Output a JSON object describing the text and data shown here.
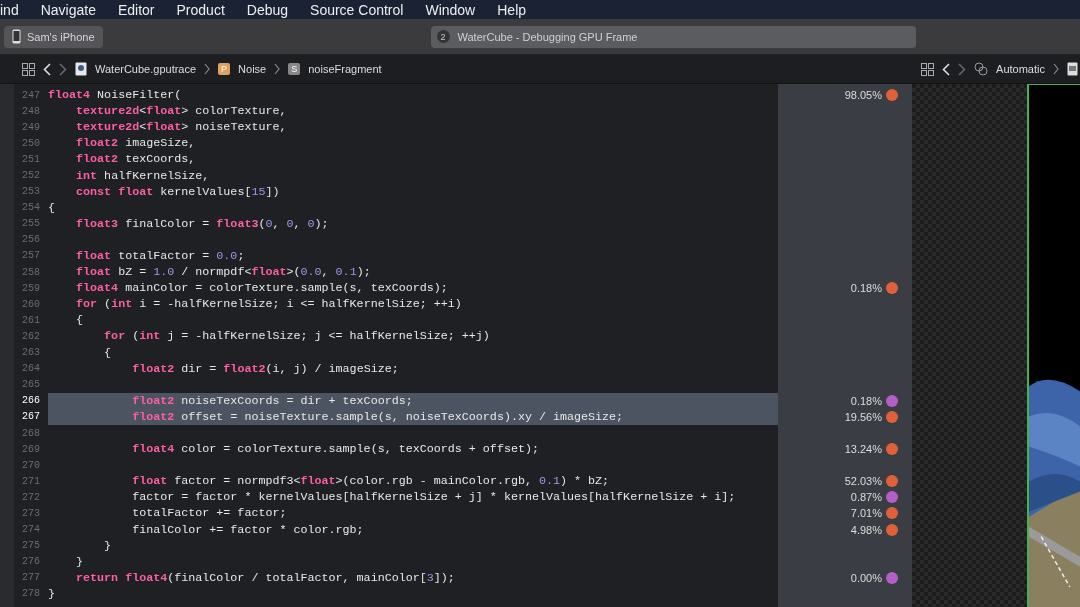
{
  "menu_bar": [
    "ind",
    "Navigate",
    "Editor",
    "Product",
    "Debug",
    "Source Control",
    "Window",
    "Help"
  ],
  "toolbar": {
    "scheme": "Sam's iPhone",
    "activity": {
      "badge": "2",
      "title": "WaterCube - Debugging GPU Frame"
    }
  },
  "jump_bar": {
    "path": [
      {
        "label": "WaterCube.gputrace"
      },
      {
        "label": "Noise",
        "badge": "P"
      },
      {
        "label": "noiseFragment",
        "badge": "S"
      }
    ],
    "assistant": "Automatic"
  },
  "lines": [
    {
      "n": "247",
      "selected": false,
      "code": [
        {
          "kind": "keyword",
          "text": "float4"
        },
        {
          "kind": "plain",
          "text": " NoiseFilter("
        }
      ],
      "cost": "98.05%",
      "color": "#e0603a"
    },
    {
      "n": "248",
      "selected": false,
      "code": [
        {
          "kind": "keyword",
          "text": "    texture2d"
        },
        {
          "kind": "plain",
          "text": "<"
        },
        {
          "kind": "keyword",
          "text": "float"
        },
        {
          "kind": "plain",
          "text": "> colorTexture,"
        }
      ]
    },
    {
      "n": "249",
      "selected": false,
      "code": [
        {
          "kind": "keyword",
          "text": "    texture2d"
        },
        {
          "kind": "plain",
          "text": "<"
        },
        {
          "kind": "keyword",
          "text": "float"
        },
        {
          "kind": "plain",
          "text": "> noiseTexture,"
        }
      ]
    },
    {
      "n": "250",
      "selected": false,
      "code": [
        {
          "kind": "keyword",
          "text": "    float2"
        },
        {
          "kind": "plain",
          "text": " imageSize,"
        }
      ]
    },
    {
      "n": "251",
      "selected": false,
      "code": [
        {
          "kind": "keyword",
          "text": "    float2"
        },
        {
          "kind": "plain",
          "text": " texCoords,"
        }
      ]
    },
    {
      "n": "252",
      "selected": false,
      "code": [
        {
          "kind": "keyword",
          "text": "    int"
        },
        {
          "kind": "plain",
          "text": " halfKernelSize,"
        }
      ]
    },
    {
      "n": "253",
      "selected": false,
      "code": [
        {
          "kind": "keyword",
          "text": "    const float"
        },
        {
          "kind": "plain",
          "text": " kernelValues["
        },
        {
          "kind": "number",
          "text": "15"
        },
        {
          "kind": "plain",
          "text": "])"
        }
      ]
    },
    {
      "n": "254",
      "selected": false,
      "code": [
        {
          "kind": "plain",
          "text": "{"
        }
      ]
    },
    {
      "n": "255",
      "selected": false,
      "code": [
        {
          "kind": "keyword",
          "text": "    float3"
        },
        {
          "kind": "plain",
          "text": " finalColor = "
        },
        {
          "kind": "keyword",
          "text": "float3"
        },
        {
          "kind": "plain",
          "text": "("
        },
        {
          "kind": "number",
          "text": "0"
        },
        {
          "kind": "plain",
          "text": ", "
        },
        {
          "kind": "number",
          "text": "0"
        },
        {
          "kind": "plain",
          "text": ", "
        },
        {
          "kind": "number",
          "text": "0"
        },
        {
          "kind": "plain",
          "text": ");"
        }
      ]
    },
    {
      "n": "256",
      "selected": false
    },
    {
      "n": "257",
      "selected": false,
      "code": [
        {
          "kind": "keyword",
          "text": "    float"
        },
        {
          "kind": "plain",
          "text": " totalFactor = "
        },
        {
          "kind": "number",
          "text": "0.0"
        },
        {
          "kind": "plain",
          "text": ";"
        }
      ]
    },
    {
      "n": "258",
      "selected": false,
      "code": [
        {
          "kind": "keyword",
          "text": "    float"
        },
        {
          "kind": "plain",
          "text": " bZ = "
        },
        {
          "kind": "number",
          "text": "1.0"
        },
        {
          "kind": "plain",
          "text": " / normpdf<"
        },
        {
          "kind": "keyword",
          "text": "float"
        },
        {
          "kind": "plain",
          "text": ">("
        },
        {
          "kind": "number",
          "text": "0.0"
        },
        {
          "kind": "plain",
          "text": ", "
        },
        {
          "kind": "number",
          "text": "0.1"
        },
        {
          "kind": "plain",
          "text": ");"
        }
      ]
    },
    {
      "n": "259",
      "selected": false,
      "code": [
        {
          "kind": "keyword",
          "text": "    float4"
        },
        {
          "kind": "plain",
          "text": " mainColor = colorTexture.sample(s, texCoords);"
        }
      ],
      "cost": "0.18%",
      "color": "#e0603a"
    },
    {
      "n": "260",
      "selected": false,
      "code": [
        {
          "kind": "keyword",
          "text": "    for"
        },
        {
          "kind": "plain",
          "text": " ("
        },
        {
          "kind": "keyword",
          "text": "int"
        },
        {
          "kind": "plain",
          "text": " i = -halfKernelSize; i <= halfKernelSize; ++i)"
        }
      ]
    },
    {
      "n": "261",
      "selected": false,
      "code": [
        {
          "kind": "plain",
          "text": "    {"
        }
      ]
    },
    {
      "n": "262",
      "selected": false,
      "code": [
        {
          "kind": "keyword",
          "text": "        for"
        },
        {
          "kind": "plain",
          "text": " ("
        },
        {
          "kind": "keyword",
          "text": "int"
        },
        {
          "kind": "plain",
          "text": " j = -halfKernelSize; j <= halfKernelSize; ++j)"
        }
      ]
    },
    {
      "n": "263",
      "selected": false,
      "code": [
        {
          "kind": "plain",
          "text": "        {"
        }
      ]
    },
    {
      "n": "264",
      "selected": false,
      "code": [
        {
          "kind": "keyword",
          "text": "            float2"
        },
        {
          "kind": "plain",
          "text": " dir = "
        },
        {
          "kind": "keyword",
          "text": "float2"
        },
        {
          "kind": "plain",
          "text": "(i, j) / imageSize;"
        }
      ]
    },
    {
      "n": "265",
      "selected": false
    },
    {
      "n": "266",
      "selected": true,
      "code": [
        {
          "kind": "keyword",
          "text": "            float2"
        },
        {
          "kind": "plain",
          "text": " noiseTexCoords = dir + texCoords;"
        }
      ],
      "cost": "0.18%",
      "color": "#b45fc8"
    },
    {
      "n": "267",
      "selected": true,
      "code": [
        {
          "kind": "keyword",
          "text": "            float2"
        },
        {
          "kind": "plain",
          "text": " offset = noiseTexture.sample(s, noiseTexCoords).xy / imageSize;"
        }
      ],
      "cost": "19.56%",
      "color": "#e0603a"
    },
    {
      "n": "268",
      "selected": false
    },
    {
      "n": "269",
      "selected": false,
      "code": [
        {
          "kind": "keyword",
          "text": "            float4"
        },
        {
          "kind": "plain",
          "text": " color = colorTexture.sample(s, texCoords + offset);"
        }
      ],
      "cost": "13.24%",
      "color": "#e0603a"
    },
    {
      "n": "270",
      "selected": false
    },
    {
      "n": "271",
      "selected": false,
      "code": [
        {
          "kind": "keyword",
          "text": "            float"
        },
        {
          "kind": "plain",
          "text": " factor = normpdf3<"
        },
        {
          "kind": "keyword",
          "text": "float"
        },
        {
          "kind": "plain",
          "text": ">(color.rgb - mainColor.rgb, "
        },
        {
          "kind": "number",
          "text": "0.1"
        },
        {
          "kind": "plain",
          "text": ") * bZ;"
        }
      ],
      "cost": "52.03%",
      "color": "#e0603a"
    },
    {
      "n": "272",
      "selected": false,
      "code": [
        {
          "kind": "plain",
          "text": "            factor = factor * kernelValues[halfKernelSize + j] * kernelValues[halfKernelSize + i];"
        }
      ],
      "cost": "0.87%",
      "color": "#b45fc8"
    },
    {
      "n": "273",
      "selected": false,
      "code": [
        {
          "kind": "plain",
          "text": "            totalFactor += factor;"
        }
      ],
      "cost": "7.01%",
      "color": "#e0603a"
    },
    {
      "n": "274",
      "selected": false,
      "code": [
        {
          "kind": "plain",
          "text": "            finalColor += factor * color.rgb;"
        }
      ],
      "cost": "4.98%",
      "color": "#e0603a"
    },
    {
      "n": "275",
      "selected": false,
      "code": [
        {
          "kind": "plain",
          "text": "        }"
        }
      ]
    },
    {
      "n": "276",
      "selected": false,
      "code": [
        {
          "kind": "plain",
          "text": "    }"
        }
      ]
    },
    {
      "n": "277",
      "selected": false,
      "code": [
        {
          "kind": "keyword",
          "text": "    return float4"
        },
        {
          "kind": "plain",
          "text": "(finalColor / totalFactor, mainColor["
        },
        {
          "kind": "number",
          "text": "3"
        },
        {
          "kind": "plain",
          "text": "]);"
        }
      ],
      "cost": "0.00%",
      "color": "#b45fc8"
    },
    {
      "n": "278",
      "selected": false,
      "code": [
        {
          "kind": "plain",
          "text": "}"
        }
      ]
    }
  ]
}
